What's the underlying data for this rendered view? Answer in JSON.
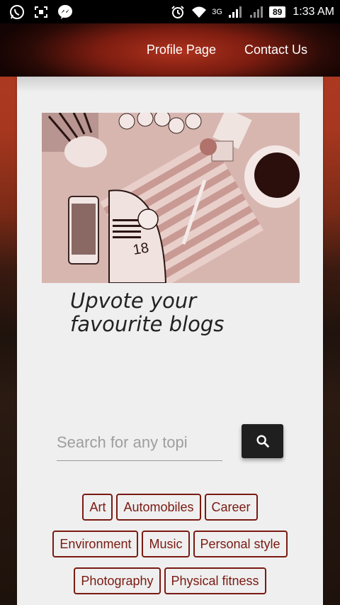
{
  "status_bar": {
    "network": "3G",
    "battery": "89",
    "time": "1:33 AM",
    "icons": [
      "whatsapp-icon",
      "screenshot-icon",
      "messenger-icon",
      "alarm-icon",
      "wifi-icon",
      "signal-icon",
      "battery-icon"
    ]
  },
  "nav": {
    "links": [
      "Profile Page",
      "Contact Us"
    ]
  },
  "hero": {
    "tagline": "Upvote your favourite blogs"
  },
  "search": {
    "placeholder": "Search for any topi",
    "button_icon": "search-icon"
  },
  "tags": [
    [
      "Art",
      "Automobiles",
      "Career"
    ],
    [
      "Environment",
      "Music",
      "Personal style"
    ],
    [
      "Photography",
      "Physical fitness"
    ]
  ],
  "colors": {
    "accent": "#7a1a12",
    "card_bg": "#efefef",
    "button_bg": "#1f1f1f"
  }
}
